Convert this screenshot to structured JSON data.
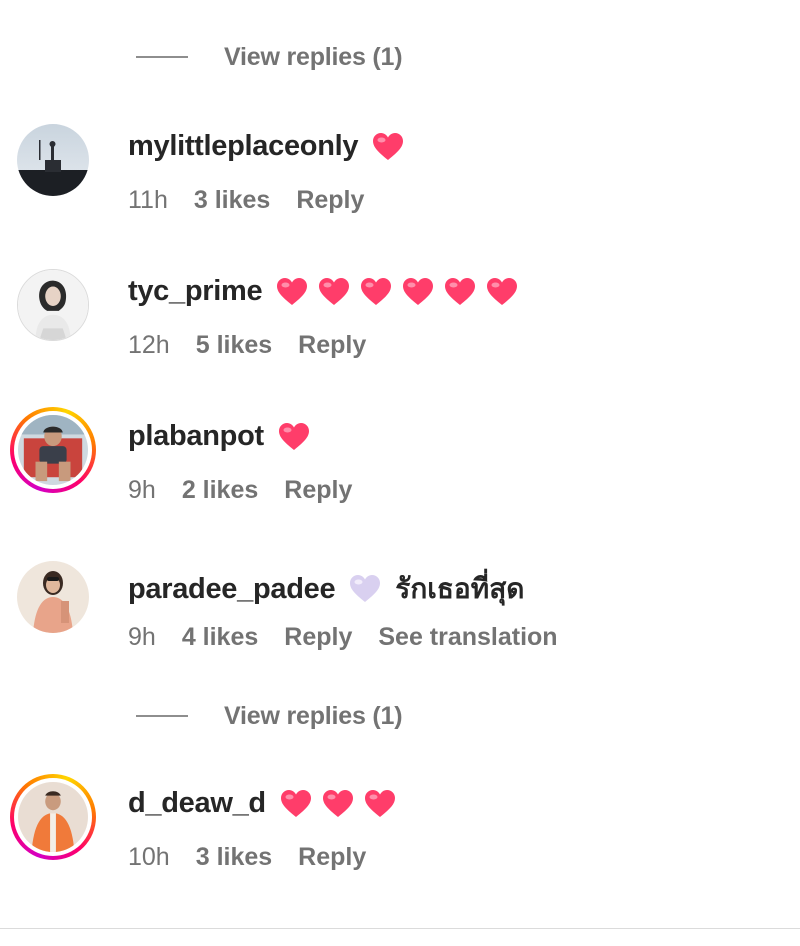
{
  "view_replies": [
    {
      "label": "View replies (1)"
    },
    {
      "label": "View replies (1)"
    }
  ],
  "comments": [
    {
      "username": "mylittleplaceonly",
      "emoji_count": 1,
      "heart_color": "#ff3d6a",
      "text": "",
      "time": "11h",
      "likes": "3 likes",
      "reply": "Reply"
    },
    {
      "username": "tyc_prime",
      "emoji_count": 6,
      "heart_color": "#ff3d6a",
      "text": "",
      "time": "12h",
      "likes": "5 likes",
      "reply": "Reply"
    },
    {
      "username": "plabanpot",
      "emoji_count": 1,
      "heart_color": "#ff3d6a",
      "text": "",
      "time": "9h",
      "likes": "2 likes",
      "reply": "Reply"
    },
    {
      "username": "paradee_padee",
      "emoji_count": 1,
      "heart_color": "#d9d0f0",
      "text": "รักเธอที่สุด",
      "time": "9h",
      "likes": "4 likes",
      "reply": "Reply",
      "see_translation": "See translation"
    },
    {
      "username": "d_deaw_d",
      "emoji_count": 3,
      "heart_color": "#ff3d6a",
      "text": "",
      "time": "10h",
      "likes": "3 likes",
      "reply": "Reply"
    }
  ],
  "icons": {
    "heart": "heart-emoji-icon",
    "line": "reply-thread-line"
  },
  "colors": {
    "username": "#262626",
    "meta": "#737373",
    "story_ring": "#d300c5"
  }
}
